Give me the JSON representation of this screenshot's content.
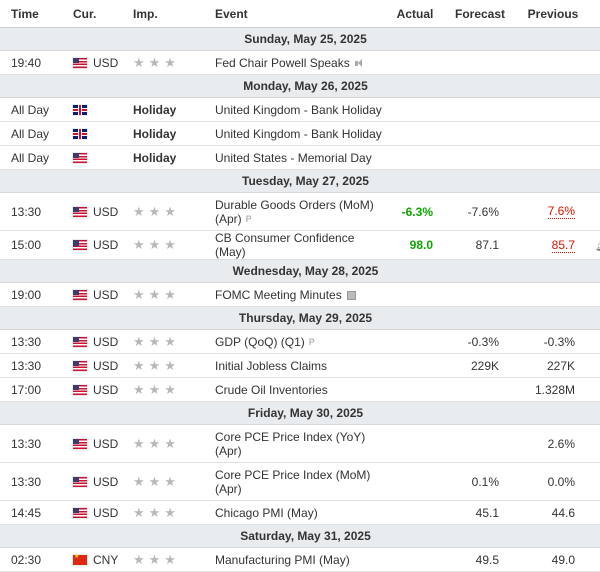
{
  "headers": {
    "time": "Time",
    "cur": "Cur.",
    "imp": "Imp.",
    "event": "Event",
    "actual": "Actual",
    "forecast": "Forecast",
    "previous": "Previous"
  },
  "days": [
    {
      "label": "Sunday, May 25, 2025",
      "events": [
        {
          "time": "19:40",
          "cur": "USD",
          "flag": "us",
          "event": "Fed Chair Powell Speaks",
          "icon": "speaker-icon",
          "actual": "",
          "forecast": "",
          "previous": ""
        }
      ]
    },
    {
      "label": "Monday, May 26, 2025",
      "events": [
        {
          "time": "All Day",
          "flag": "uk",
          "imp": "Holiday",
          "event": "United Kingdom - Bank Holiday"
        },
        {
          "time": "All Day",
          "flag": "uk",
          "imp": "Holiday",
          "event": "United Kingdom - Bank Holiday"
        },
        {
          "time": "All Day",
          "flag": "us",
          "imp": "Holiday",
          "event": "United States - Memorial Day"
        }
      ]
    },
    {
      "label": "Tuesday, May 27, 2025",
      "events": [
        {
          "time": "13:30",
          "cur": "USD",
          "flag": "us",
          "event_line1": "Durable Goods Orders (MoM)",
          "event_line2": "(Apr)",
          "icon": "preliminary-icon",
          "actual": "-6.3%",
          "actual_color": "#0ea600",
          "forecast": "-7.6%",
          "previous": "7.6%",
          "previous_color": "#d91400"
        },
        {
          "time": "15:00",
          "cur": "USD",
          "flag": "us",
          "event": "CB Consumer Confidence (May)",
          "actual": "98.0",
          "actual_color": "#0ea600",
          "forecast": "87.1",
          "previous": "85.7",
          "previous_color": "#d91400",
          "alert_icon": "bell-plus-icon"
        }
      ]
    },
    {
      "label": "Wednesday, May 28, 2025",
      "events": [
        {
          "time": "19:00",
          "cur": "USD",
          "flag": "us",
          "event": "FOMC Meeting Minutes",
          "icon": "document-icon"
        }
      ]
    },
    {
      "label": "Thursday, May 29, 2025",
      "events": [
        {
          "time": "13:30",
          "cur": "USD",
          "flag": "us",
          "event": "GDP (QoQ) (Q1)",
          "icon": "preliminary-icon",
          "forecast": "-0.3%",
          "previous": "-0.3%"
        },
        {
          "time": "13:30",
          "cur": "USD",
          "flag": "us",
          "event": "Initial Jobless Claims",
          "forecast": "229K",
          "previous": "227K"
        },
        {
          "time": "17:00",
          "cur": "USD",
          "flag": "us",
          "event": "Crude Oil Inventories",
          "forecast": "",
          "previous": "1.328M"
        }
      ]
    },
    {
      "label": "Friday, May 30, 2025",
      "events": [
        {
          "time": "13:30",
          "cur": "USD",
          "flag": "us",
          "event_line1": "Core PCE Price Index (YoY)",
          "event_line2": "(Apr)",
          "forecast": "",
          "previous": "2.6%"
        },
        {
          "time": "13:30",
          "cur": "USD",
          "flag": "us",
          "event_line1": "Core PCE Price Index (MoM)",
          "event_line2": "(Apr)",
          "forecast": "0.1%",
          "previous": "0.0%"
        },
        {
          "time": "14:45",
          "cur": "USD",
          "flag": "us",
          "event": "Chicago PMI (May)",
          "forecast": "45.1",
          "previous": "44.6"
        }
      ]
    },
    {
      "label": "Saturday, May 31, 2025",
      "events": [
        {
          "time": "02:30",
          "cur": "CNY",
          "flag": "cn",
          "event": "Manufacturing PMI (May)",
          "forecast": "49.5",
          "previous": "49.0"
        }
      ]
    }
  ],
  "importance": {
    "stars": 3,
    "star_color": "#b8b8b8"
  },
  "colors": {
    "positive": "#0ea600",
    "negative": "#d91400",
    "day_header_bg": "#e9ecef"
  }
}
